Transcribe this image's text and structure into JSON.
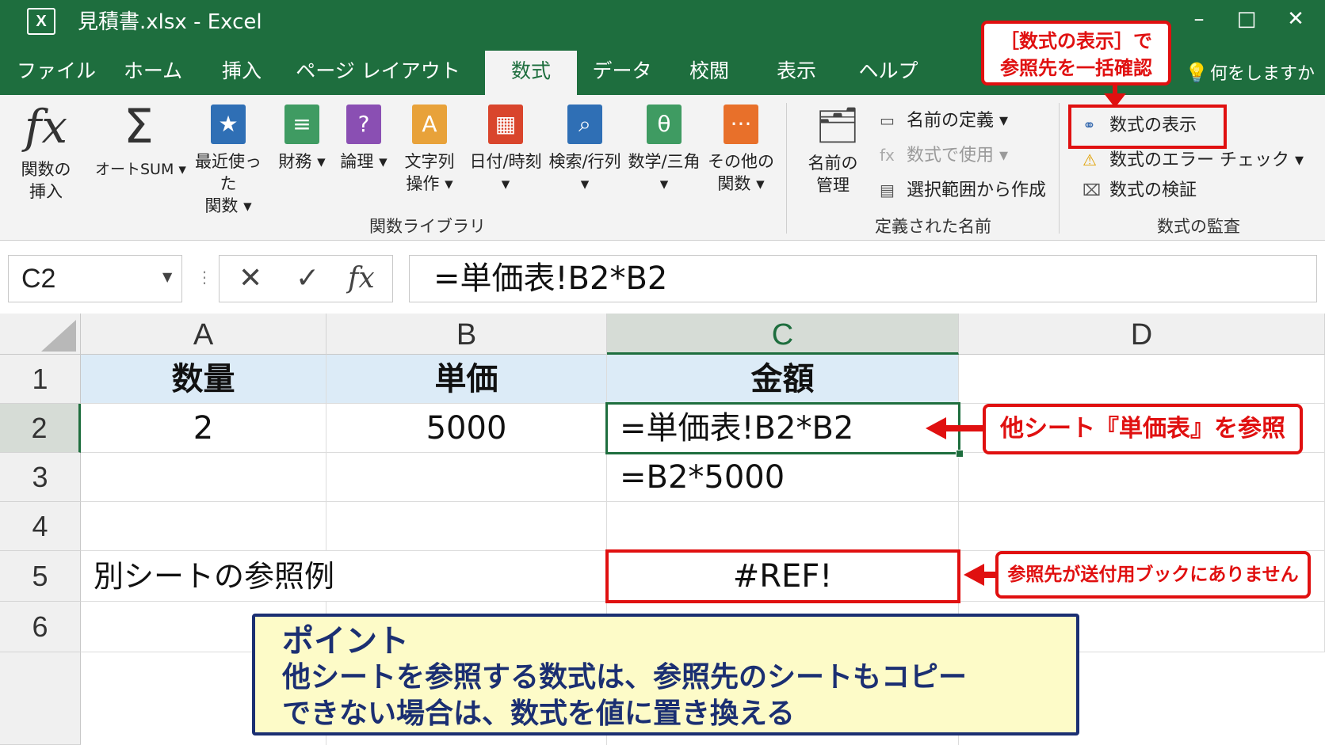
{
  "window": {
    "app_icon_text": "X",
    "title": "見積書.xlsx - Excel",
    "minimize": "–",
    "maximize": "□",
    "close": "✕"
  },
  "tabs": [
    {
      "label": "ファイル"
    },
    {
      "label": "ホーム"
    },
    {
      "label": "挿入"
    },
    {
      "label": "ページ レイアウト"
    },
    {
      "label": "数式",
      "active": true
    },
    {
      "label": "データ"
    },
    {
      "label": "校閲"
    },
    {
      "label": "表示"
    },
    {
      "label": "ヘルプ"
    }
  ],
  "tell_me": "何をしますか",
  "ribbon": {
    "function_library": {
      "label": "関数ライブラリ",
      "insert_function": {
        "line1": "関数の",
        "line2": "挿入",
        "icon": "fx-icon"
      },
      "autosum": {
        "line1": "オートSUM ▾",
        "icon": "sigma-icon"
      },
      "recent": {
        "line1": "最近使った",
        "line2": "関数 ▾",
        "icon": "star-book-icon",
        "color": "#2f6fb5"
      },
      "financial": {
        "line1": "財務 ▾",
        "icon": "money-book-icon",
        "color": "#3f9b62"
      },
      "logical": {
        "line1": "論理 ▾",
        "icon": "question-book-icon",
        "color": "#8a4fb3"
      },
      "text": {
        "line1": "文字列",
        "line2": "操作 ▾",
        "icon": "text-book-icon",
        "color": "#e8a23a"
      },
      "datetime": {
        "line1": "日付/時刻",
        "line2": "▾",
        "icon": "calendar-book-icon",
        "color": "#d9452c"
      },
      "lookup": {
        "line1": "検索/行列",
        "line2": "▾",
        "icon": "search-book-icon",
        "color": "#2f6fb5"
      },
      "math": {
        "line1": "数学/三角",
        "line2": "▾",
        "icon": "theta-book-icon",
        "color": "#3f9b62"
      },
      "more": {
        "line1": "その他の",
        "line2": "関数 ▾",
        "icon": "more-book-icon",
        "color": "#e8702a"
      }
    },
    "defined_names": {
      "label": "定義された名前",
      "name_manager": {
        "line1": "名前の",
        "line2": "管理",
        "icon": "name-manager-icon"
      },
      "define_name": "名前の定義 ▾",
      "use_in_formula": "数式で使用 ▾",
      "create_from_selection": "選択範囲から作成"
    },
    "formula_auditing": {
      "label": "数式の監査",
      "show_formulas": "数式の表示",
      "error_checking": "数式のエラー チェック ▾",
      "evaluate_formula": "数式の検証"
    }
  },
  "formula_bar": {
    "name_box": "C2",
    "cancel": "✕",
    "enter": "✓",
    "fx": "fx",
    "formula": "=単価表!B2*B2"
  },
  "sheet": {
    "columns": [
      "A",
      "B",
      "C",
      "D"
    ],
    "selected_column": "C",
    "rows": [
      "1",
      "2",
      "3",
      "4",
      "5",
      "6"
    ],
    "selected_row": "2",
    "cells": {
      "A1": "数量",
      "B1": "単価",
      "C1": "金額",
      "A2": "2",
      "B2": "5000",
      "C2": "=単価表!B2*B2",
      "C3": "=B2*5000",
      "A5": "別シートの参照例",
      "C5": "#REF!"
    }
  },
  "annotations": {
    "show_formulas_callout_line1": "［数式の表示］で",
    "show_formulas_callout_line2": "参照先を一括確認",
    "other_sheet_callout": "他シート『単価表』を参照",
    "ref_error_callout": "参照先が送付用ブックにありません",
    "point_title": "ポイント",
    "point_line1": "他シートを参照する数式は、参照先のシートもコピー",
    "point_line2": "できない場合は、数式を値に置き換える",
    "accent_color": "#e01010",
    "point_border_color": "#1b2f72",
    "point_bg_color": "#fdfbc8"
  },
  "colors": {
    "excel_green": "#1e6e3e",
    "header_fill": "#dcebf7"
  }
}
